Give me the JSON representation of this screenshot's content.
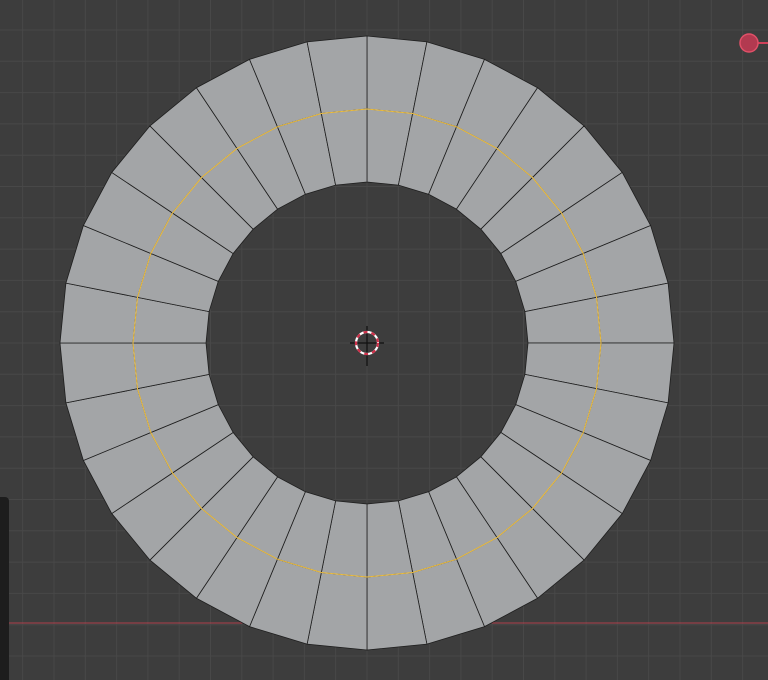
{
  "viewport": {
    "mesh": {
      "type": "ring",
      "segments": 32
    },
    "colors": {
      "background": "#3d3d3d",
      "grid": "#484848",
      "face": "#a3a5a7",
      "edge": "#1e1e1e",
      "selected_loop": "#f5c542",
      "x_axis": "#c0404c",
      "cursor_red": "#d0304a",
      "gizmo": "#d04058"
    }
  }
}
